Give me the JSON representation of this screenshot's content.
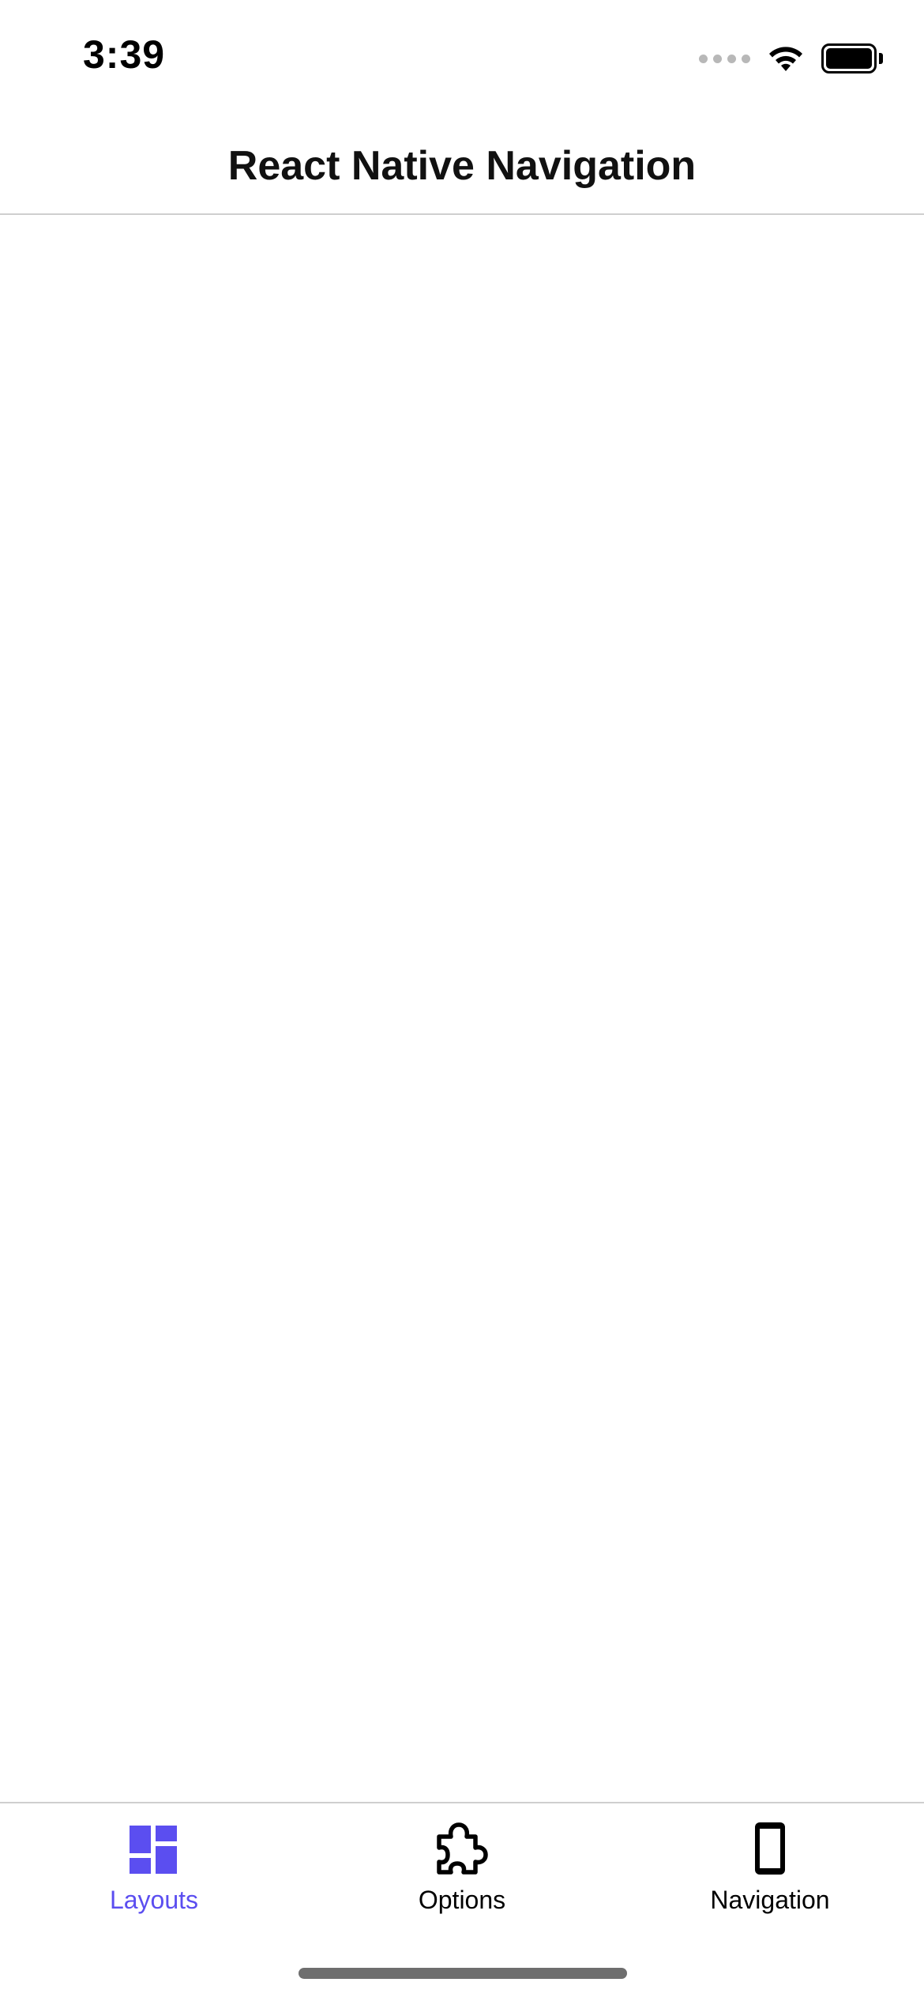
{
  "status_bar": {
    "time": "3:39",
    "signal_icon": "cellular-signal-icon",
    "wifi_icon": "wifi-icon",
    "battery_icon": "battery-icon",
    "battery_level_fraction": 1.0
  },
  "nav_bar": {
    "title": "React Native Navigation"
  },
  "tab_bar": {
    "accent_color": "#5b4ef0",
    "inactive_color": "#000000",
    "tabs": [
      {
        "label": "Layouts",
        "icon": "dashboard-layout-icon",
        "active": true
      },
      {
        "label": "Options",
        "icon": "puzzle-piece-icon",
        "active": false
      },
      {
        "label": "Navigation",
        "icon": "smartphone-icon",
        "active": false
      }
    ]
  }
}
